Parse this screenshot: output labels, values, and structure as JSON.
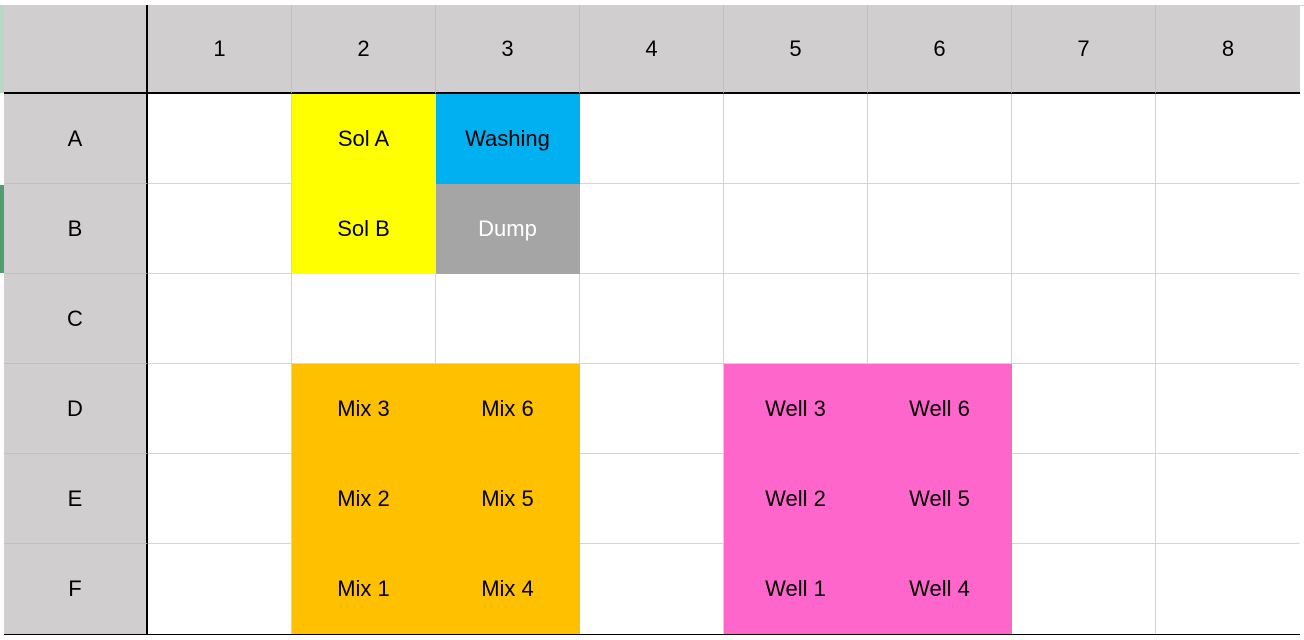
{
  "columns": [
    "1",
    "2",
    "3",
    "4",
    "5",
    "6",
    "7",
    "8"
  ],
  "rows": [
    "A",
    "B",
    "C",
    "D",
    "E",
    "F"
  ],
  "cells": {
    "A": [
      "",
      "Sol A",
      "Washing",
      "",
      "",
      "",
      "",
      ""
    ],
    "B": [
      "",
      "Sol B",
      "Dump",
      "",
      "",
      "",
      "",
      ""
    ],
    "C": [
      "",
      "",
      "",
      "",
      "",
      "",
      "",
      ""
    ],
    "D": [
      "",
      "Mix 3",
      "Mix 6",
      "",
      "Well 3",
      "Well 6",
      "",
      ""
    ],
    "E": [
      "",
      "Mix 2",
      "Mix 5",
      "",
      "Well 2",
      "Well 5",
      "",
      ""
    ],
    "F": [
      "",
      "Mix 1",
      "Mix 4",
      "",
      "Well 1",
      "Well 4",
      "",
      ""
    ]
  },
  "fills": {
    "A": [
      "",
      "yellow",
      "blue",
      "",
      "",
      "",
      "",
      ""
    ],
    "B": [
      "",
      "yellow",
      "gray",
      "",
      "",
      "",
      "",
      ""
    ],
    "C": [
      "",
      "",
      "",
      "",
      "",
      "",
      "",
      ""
    ],
    "D": [
      "",
      "orange",
      "orange",
      "",
      "pink",
      "pink",
      "",
      ""
    ],
    "E": [
      "",
      "orange",
      "orange",
      "",
      "pink",
      "pink",
      "",
      ""
    ],
    "F": [
      "",
      "orange",
      "orange",
      "",
      "pink",
      "pink",
      "",
      ""
    ]
  },
  "colors": {
    "header_bg": "#d0cece",
    "yellow": "#ffff00",
    "blue": "#00b0f0",
    "gray": "#a5a5a5",
    "orange": "#ffc000",
    "pink": "#ff66cc"
  }
}
